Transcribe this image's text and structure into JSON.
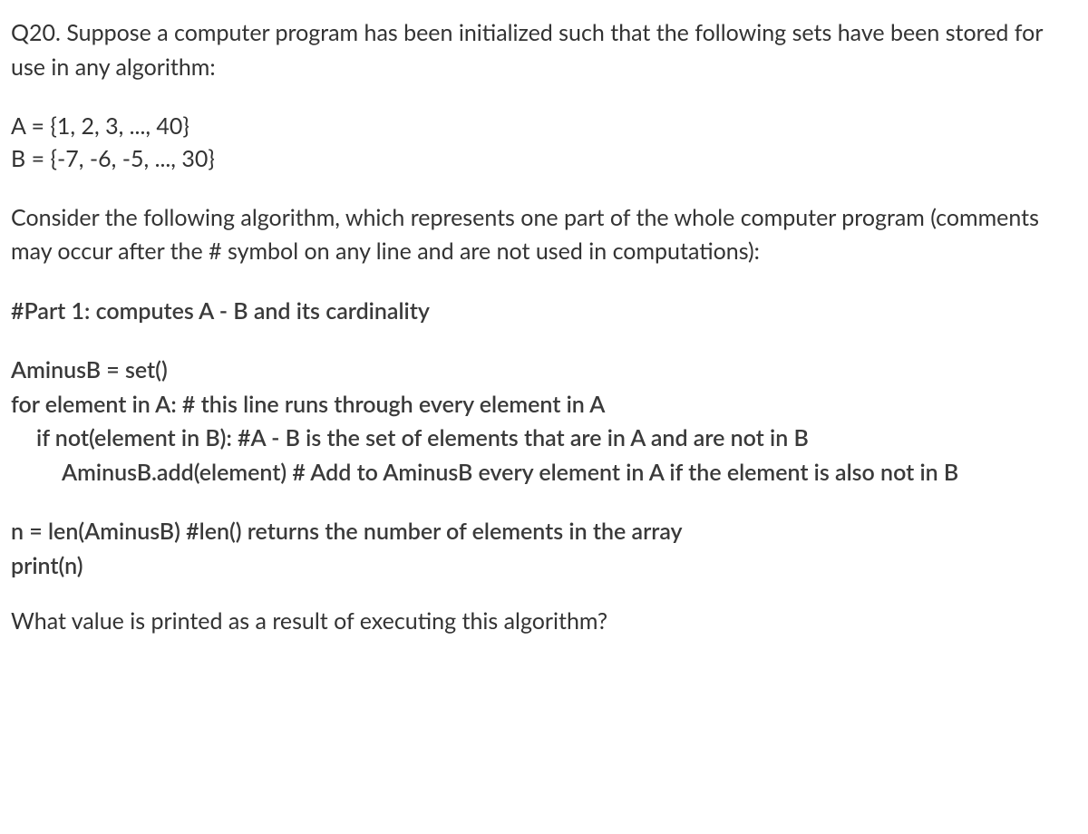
{
  "intro": "Q20. Suppose a computer program has been initialized such that the following sets have been stored for use in any algorithm:",
  "sets": {
    "A": "A = {1, 2, 3, ..., 40}",
    "B": "B = {-7, -6, -5, ..., 30}"
  },
  "algo_intro": "Consider the following algorithm, which represents one part of the whole computer program (comments may occur after the # symbol on any line and are not used in computations):",
  "part_title": "#Part 1: computes A - B and its cardinality",
  "code": {
    "line1": "AminusB = set()",
    "line2": "for element in A:   # this line runs through every element in A",
    "line3": "if not(element in B): #A - B is the set of elements that are in A and are not in B",
    "line4": "AminusB.add(element) # Add to AminusB every element in A if the element is also not in B",
    "line5": "n = len(AminusB) #len() returns the number of elements in the array",
    "line6": "print(n)"
  },
  "final_prompt": "What value is printed as a result of executing this algorithm?"
}
